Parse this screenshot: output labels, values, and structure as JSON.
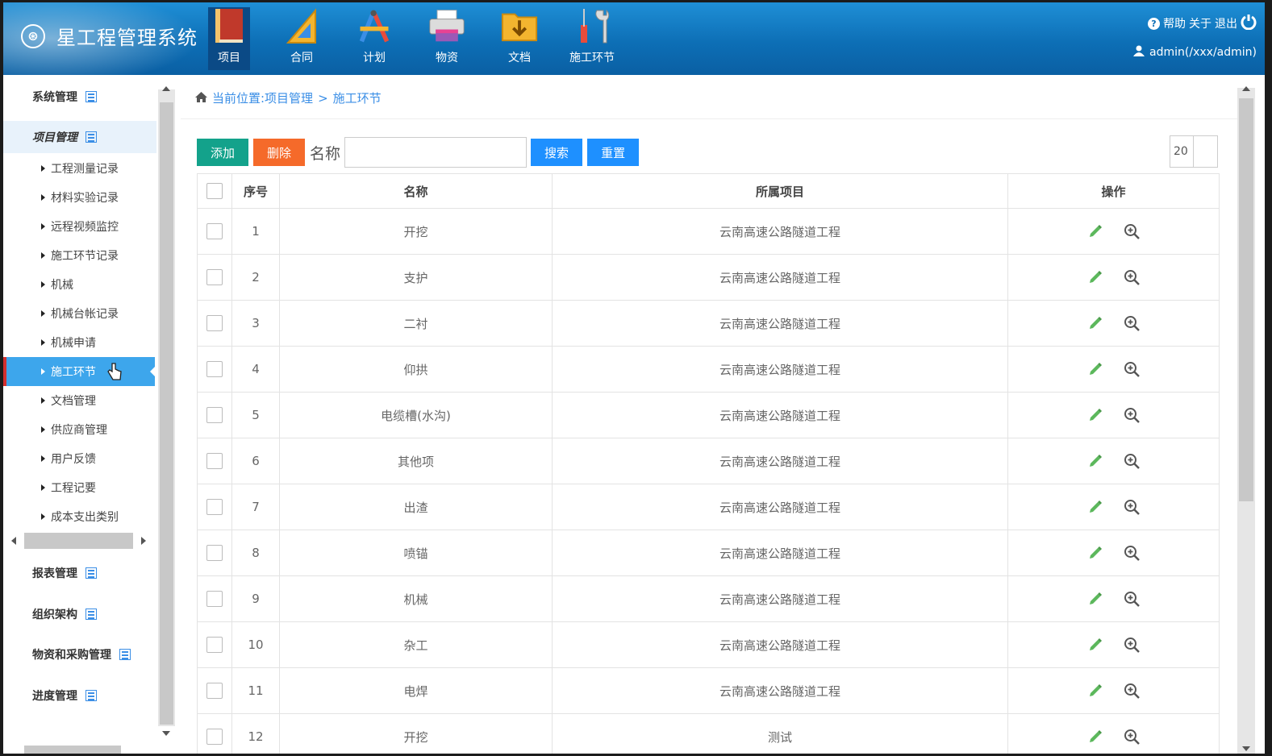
{
  "app": {
    "title": "星工程管理系统",
    "logo_glyph": "⊛"
  },
  "nav": [
    {
      "label": "项目",
      "icon": "book-icon",
      "active": true
    },
    {
      "label": "合同",
      "icon": "ruler-triangle-icon",
      "active": false
    },
    {
      "label": "计划",
      "icon": "compass-pencil-icon",
      "active": false
    },
    {
      "label": "物资",
      "icon": "printer-icon",
      "active": false
    },
    {
      "label": "文档",
      "icon": "folder-download-icon",
      "active": false
    },
    {
      "label": "施工环节",
      "icon": "tools-icon",
      "active": false
    }
  ],
  "top_right": {
    "help": "帮助",
    "about": "关于",
    "logout": "退出",
    "user": "admin(/xxx/admin)"
  },
  "sidebar": {
    "groups_top": [
      {
        "label": "系统管理"
      },
      {
        "label": "项目管理"
      }
    ],
    "items": [
      {
        "label": "工程测量记录"
      },
      {
        "label": "材料实验记录"
      },
      {
        "label": "远程视频监控"
      },
      {
        "label": "施工环节记录"
      },
      {
        "label": "机械"
      },
      {
        "label": "机械台帐记录"
      },
      {
        "label": "机械申请"
      },
      {
        "label": "施工环节"
      },
      {
        "label": "文档管理"
      },
      {
        "label": "供应商管理"
      },
      {
        "label": "用户反馈"
      },
      {
        "label": "工程记要"
      },
      {
        "label": "成本支出类别"
      }
    ],
    "groups_bottom": [
      {
        "label": "报表管理"
      },
      {
        "label": "组织架构"
      },
      {
        "label": "物资和采购管理"
      },
      {
        "label": "进度管理"
      }
    ]
  },
  "breadcrumb": {
    "text": "当前位置:项目管理",
    "sep": ">",
    "current": "施工环节"
  },
  "toolbar": {
    "add": "添加",
    "delete": "删除",
    "name_label": "名称",
    "name_value": "",
    "search": "搜索",
    "reset": "重置",
    "page_size": "20"
  },
  "table": {
    "headers": {
      "index": "序号",
      "name": "名称",
      "project": "所属项目",
      "ops": "操作"
    },
    "rows": [
      {
        "index": "1",
        "name": "开挖",
        "project": "云南高速公路隧道工程"
      },
      {
        "index": "2",
        "name": "支护",
        "project": "云南高速公路隧道工程"
      },
      {
        "index": "3",
        "name": "二衬",
        "project": "云南高速公路隧道工程"
      },
      {
        "index": "4",
        "name": "仰拱",
        "project": "云南高速公路隧道工程"
      },
      {
        "index": "5",
        "name": "电缆槽(水沟)",
        "project": "云南高速公路隧道工程"
      },
      {
        "index": "6",
        "name": "其他项",
        "project": "云南高速公路隧道工程"
      },
      {
        "index": "7",
        "name": "出渣",
        "project": "云南高速公路隧道工程"
      },
      {
        "index": "8",
        "name": "喷锚",
        "project": "云南高速公路隧道工程"
      },
      {
        "index": "9",
        "name": "机械",
        "project": "云南高速公路隧道工程"
      },
      {
        "index": "10",
        "name": "杂工",
        "project": "云南高速公路隧道工程"
      },
      {
        "index": "11",
        "name": "电焊",
        "project": "云南高速公路隧道工程"
      },
      {
        "index": "12",
        "name": "开挖",
        "project": "测试"
      }
    ]
  },
  "colors": {
    "header": "#0d6fb6",
    "active_item": "#3da6ec",
    "add_btn": "#13a28b",
    "delete_btn": "#f56a2a",
    "blue_btn": "#1e90ff",
    "edit_icon": "#5cb85c"
  }
}
